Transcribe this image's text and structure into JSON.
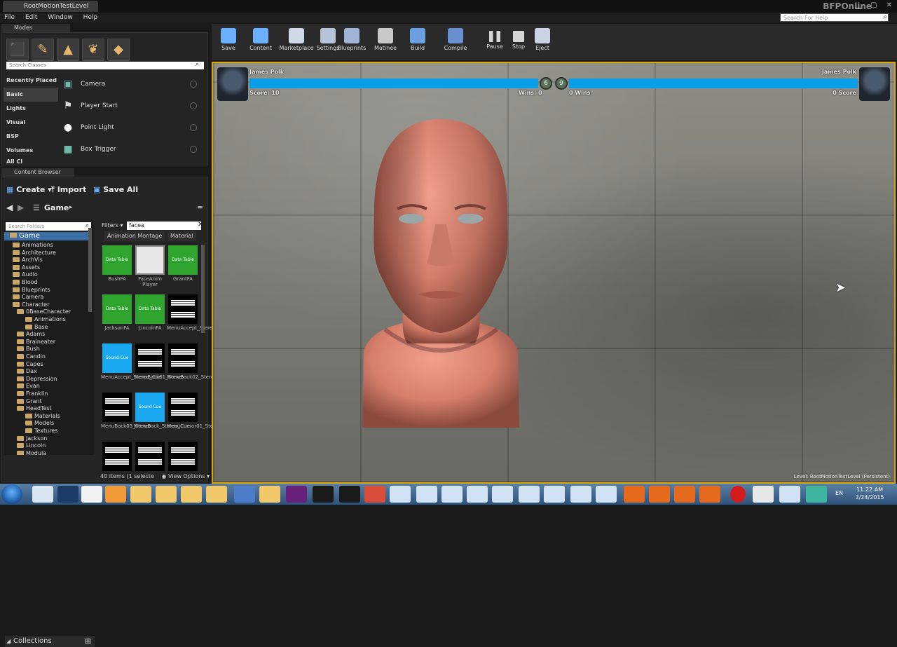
{
  "window": {
    "tab_title": "RootMotionTestLevel",
    "app_name": "BFPOnline",
    "controls": "▁ ▢ ✕"
  },
  "menu": [
    "File",
    "Edit",
    "Window",
    "Help"
  ],
  "help_search": {
    "placeholder": "Search For Help"
  },
  "modes": {
    "tab": "Modes",
    "search_placeholder": "Search Classes",
    "categories": [
      "Recently Placed",
      "Basic",
      "Lights",
      "Visual",
      "BSP",
      "Volumes",
      "All Cl"
    ],
    "active_category": "Basic",
    "items": [
      "Camera",
      "Player Start",
      "Point Light",
      "Box Trigger"
    ]
  },
  "content_browser": {
    "tab": "Content Browser",
    "create": "Create",
    "import": "Import",
    "save_all": "Save All",
    "path": "Game",
    "folder_search_placeholder": "Search Folders",
    "filters": "Filters",
    "filter_text": "facea",
    "columns": [
      "Animation Montage",
      "Material"
    ],
    "root": "Game",
    "folders": [
      {
        "name": "Animations",
        "level": 1
      },
      {
        "name": "Architecture",
        "level": 1
      },
      {
        "name": "ArchVis",
        "level": 1
      },
      {
        "name": "Assets",
        "level": 1
      },
      {
        "name": "Audio",
        "level": 1
      },
      {
        "name": "Blood",
        "level": 1
      },
      {
        "name": "Blueprints",
        "level": 1
      },
      {
        "name": "Camera",
        "level": 1
      },
      {
        "name": "Character",
        "level": 1
      },
      {
        "name": "0BaseCharacter",
        "level": 2
      },
      {
        "name": "Animations",
        "level": 3
      },
      {
        "name": "Base",
        "level": 3
      },
      {
        "name": "Adams",
        "level": 2
      },
      {
        "name": "Braineater",
        "level": 2
      },
      {
        "name": "Bush",
        "level": 2
      },
      {
        "name": "Candin",
        "level": 2
      },
      {
        "name": "Capes",
        "level": 2
      },
      {
        "name": "Dax",
        "level": 2
      },
      {
        "name": "Depression",
        "level": 2
      },
      {
        "name": "Evan",
        "level": 2
      },
      {
        "name": "Franklin",
        "level": 2
      },
      {
        "name": "Grant",
        "level": 2
      },
      {
        "name": "HeadTest",
        "level": 2
      },
      {
        "name": "Materials",
        "level": 3
      },
      {
        "name": "Models",
        "level": 3
      },
      {
        "name": "Textures",
        "level": 3
      },
      {
        "name": "Jackson",
        "level": 2
      },
      {
        "name": "Lincoln",
        "level": 2
      },
      {
        "name": "Modula",
        "level": 2
      }
    ],
    "assets": [
      {
        "label": "BushFA",
        "kind": "data",
        "thumb": "Data Table"
      },
      {
        "label": "FaceAnim Player",
        "kind": "bp",
        "thumb": ""
      },
      {
        "label": "GrantFA",
        "kind": "data",
        "thumb": "Data Table"
      },
      {
        "label": "JacksonFA",
        "kind": "data",
        "thumb": "Data Table"
      },
      {
        "label": "LincolnFA",
        "kind": "data",
        "thumb": "Data Table"
      },
      {
        "label": "MenuAccept_Stereo",
        "kind": "wave",
        "thumb": ""
      },
      {
        "label": "MenuAccept_Stereo_Cue",
        "kind": "cue",
        "thumb": "Sound Cue"
      },
      {
        "label": "MenuBack01_Stereo",
        "kind": "wave",
        "thumb": ""
      },
      {
        "label": "MenuBack02_Stereo",
        "kind": "wave",
        "thumb": ""
      },
      {
        "label": "MenuBack03_Stereo",
        "kind": "wave",
        "thumb": ""
      },
      {
        "label": "MenuBack_Stereo_Cue",
        "kind": "cue",
        "thumb": "Sound Cue"
      },
      {
        "label": "MenuCursor01_Stereo",
        "kind": "wave",
        "thumb": ""
      },
      {
        "label": "",
        "kind": "wave",
        "thumb": ""
      },
      {
        "label": "",
        "kind": "wave",
        "thumb": ""
      },
      {
        "label": "",
        "kind": "wave",
        "thumb": ""
      }
    ],
    "status": "40 items (1 selecte",
    "view_options": "View Options",
    "collections": "Collections"
  },
  "toolbar": [
    "Save",
    "Content",
    "Marketplace",
    "Settings",
    "Blueprints",
    "Matinee",
    "Build",
    "Compile",
    "Pause",
    "Stop",
    "Eject"
  ],
  "hud": {
    "player1": "James Polk",
    "player2": "James Polk",
    "score": "Score: 10",
    "wins_left": "Wins: 0",
    "wins_right": "0 Wins",
    "score_right": "0 Score",
    "coin_left": "6",
    "coin_right": "9",
    "level_label": "Level: RootMotionTestLevel (Persistent)"
  },
  "taskbar": {
    "lang": "EN",
    "time": "11:22 AM",
    "date": "2/24/2015"
  },
  "colors": {
    "accent_border": "#d9a800",
    "hp_bar": "#0a9ee6",
    "data_table": "#2fa52f",
    "sound_cue": "#1aa9f0"
  }
}
